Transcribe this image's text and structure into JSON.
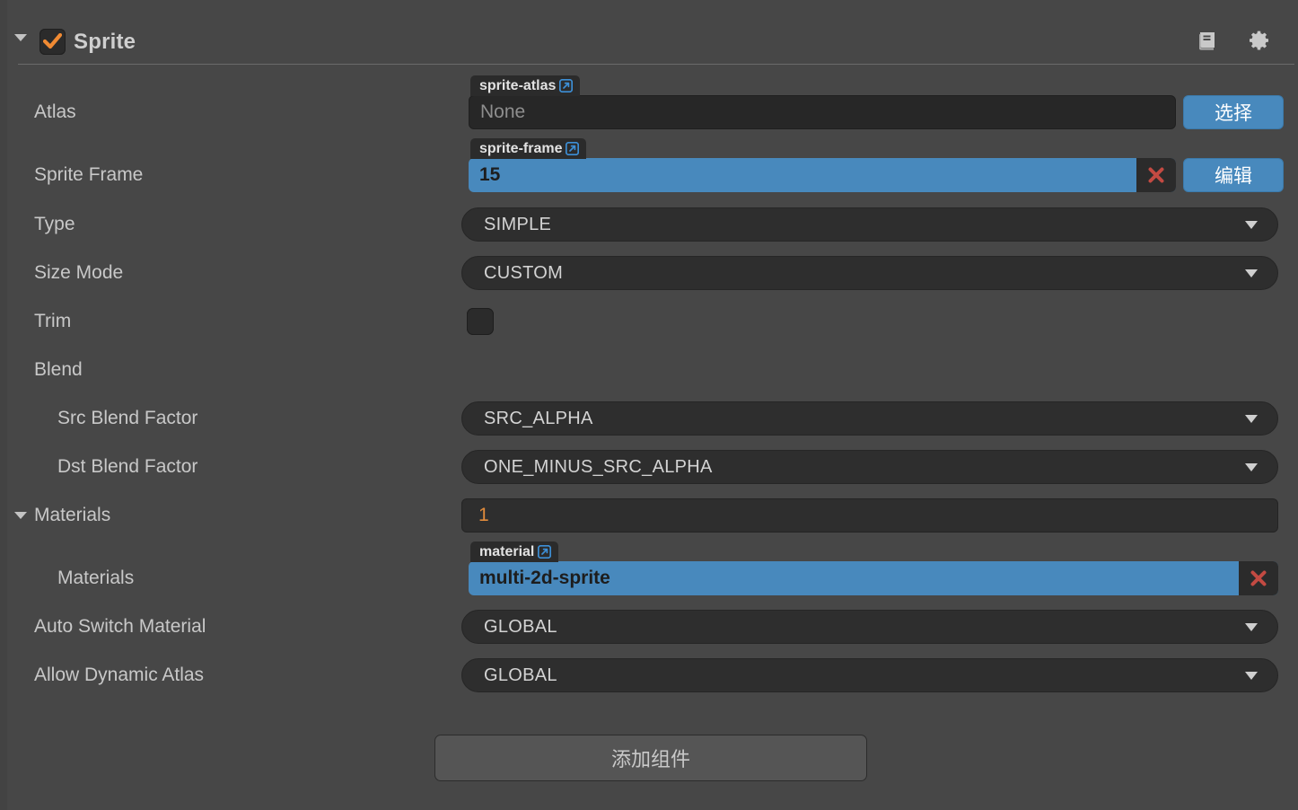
{
  "component": {
    "title": "Sprite",
    "enabled": true,
    "fold_expanded": true,
    "help_icon": "book-icon",
    "settings_icon": "gear-icon"
  },
  "colors": {
    "panel_bg": "#474747",
    "field_bg": "#2e2e2e",
    "accent_blue": "#4889bd",
    "accent_orange": "#e08b3c",
    "danger_red": "#c34a42",
    "text": "#c8c8c8"
  },
  "rows": {
    "atlas": {
      "label": "Atlas",
      "badge": "sprite-atlas",
      "badge_icon": "external-link-icon",
      "value": "None",
      "button": "选择"
    },
    "sprite_frame": {
      "label": "Sprite Frame",
      "badge": "sprite-frame",
      "badge_icon": "external-link-icon",
      "value": "15",
      "clear_icon": "close-x-icon",
      "button": "编辑"
    },
    "type": {
      "label": "Type",
      "value": "SIMPLE"
    },
    "size_mode": {
      "label": "Size Mode",
      "value": "CUSTOM"
    },
    "trim": {
      "label": "Trim",
      "checked": false
    },
    "blend": {
      "label": "Blend"
    },
    "src_blend_factor": {
      "label": "Src Blend Factor",
      "value": "SRC_ALPHA"
    },
    "dst_blend_factor": {
      "label": "Dst Blend Factor",
      "value": "ONE_MINUS_SRC_ALPHA"
    },
    "materials_group": {
      "label": "Materials",
      "count": "1",
      "fold_expanded": true
    },
    "materials_item": {
      "label": "Materials",
      "badge": "material",
      "badge_icon": "external-link-icon",
      "value": "multi-2d-sprite",
      "clear_icon": "close-x-icon"
    },
    "auto_switch_material": {
      "label": "Auto Switch Material",
      "value": "GLOBAL"
    },
    "allow_dynamic_atlas": {
      "label": "Allow Dynamic Atlas",
      "value": "GLOBAL"
    }
  },
  "footer": {
    "add_component": "添加组件"
  }
}
